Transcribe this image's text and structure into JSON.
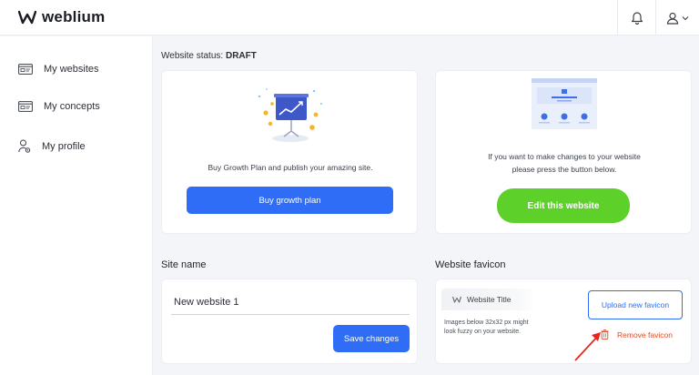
{
  "brand": {
    "name": "weblium"
  },
  "sidebar": {
    "items": [
      {
        "label": "My websites"
      },
      {
        "label": "My concepts"
      },
      {
        "label": "My profile"
      }
    ]
  },
  "status": {
    "label": "Website status:",
    "value": "DRAFT"
  },
  "growth_card": {
    "text": "Buy Growth Plan and publish your amazing site.",
    "button_label": "Buy growth plan"
  },
  "edit_card": {
    "text_line1": "If you want to make changes to your website",
    "text_line2": "please press the button below.",
    "button_label": "Edit this website"
  },
  "site_name": {
    "title": "Site name",
    "input_value": "New website 1",
    "save_label": "Save changes"
  },
  "favicon": {
    "title": "Website favicon",
    "preview_title": "Website Title",
    "note_line1": "Images below 32x32 px might",
    "note_line2": "look fuzzy on your website.",
    "upload_label": "Upload new favicon",
    "remove_label": "Remove favicon"
  },
  "colors": {
    "accent": "#2f6df6",
    "green": "#5dd02a",
    "danger": "#e8461e"
  }
}
